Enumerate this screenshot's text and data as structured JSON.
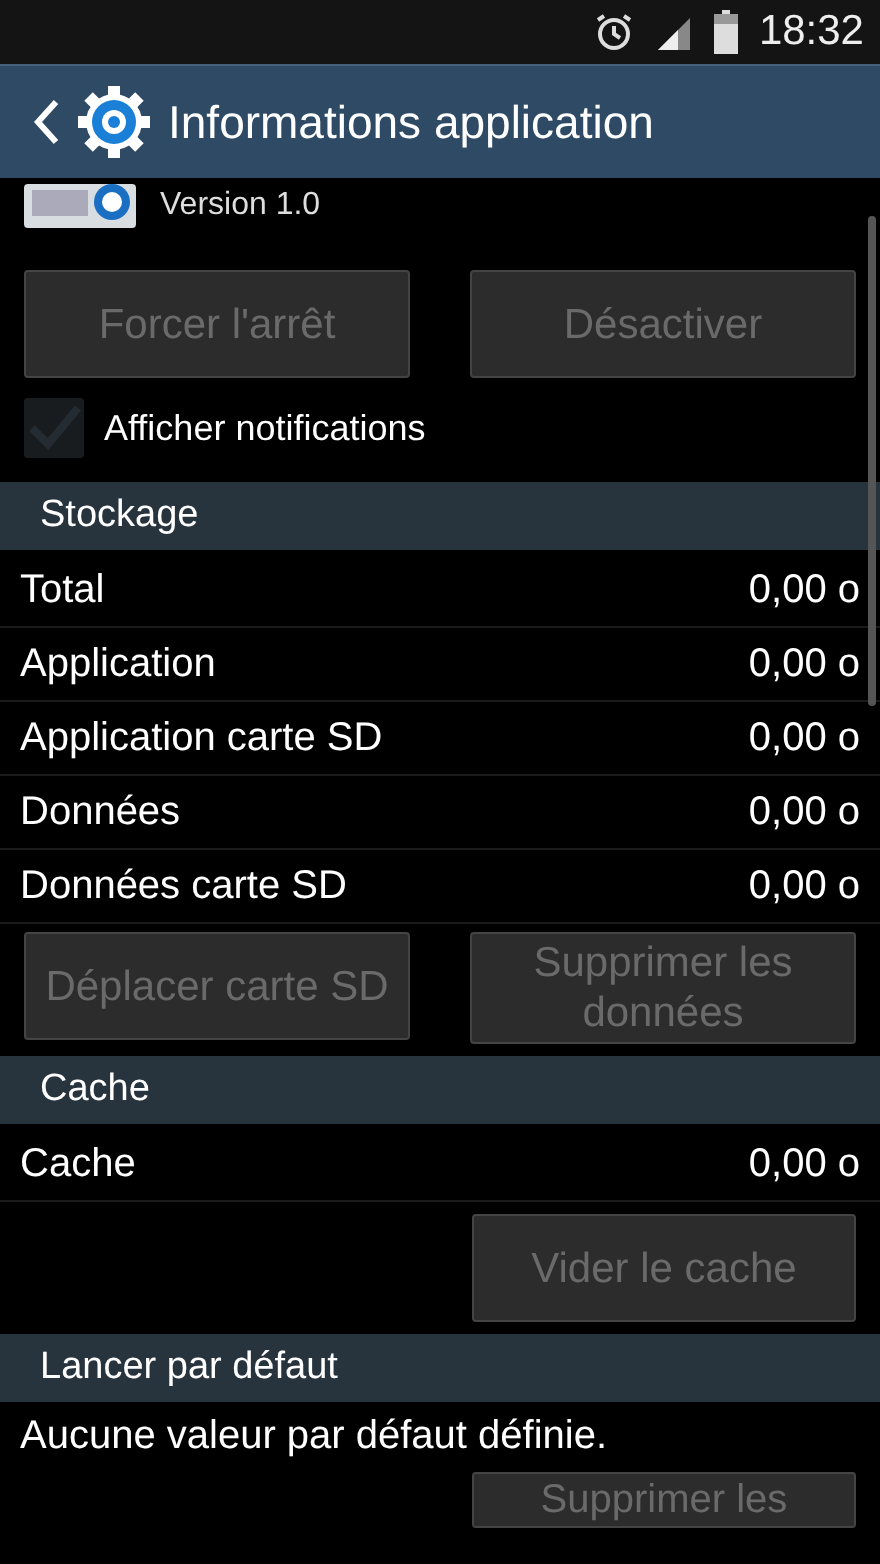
{
  "status_bar": {
    "time": "18:32"
  },
  "title_bar": {
    "title": "Informations application"
  },
  "app": {
    "version": "Version 1.0"
  },
  "app_buttons": [
    {
      "label": "Forcer l'arrêt",
      "disabled": true
    },
    {
      "label": "Désactiver",
      "disabled": true
    }
  ],
  "notifications": {
    "label": "Afficher notifications",
    "checked": true,
    "disabled": true
  },
  "storage": {
    "header": "Stockage",
    "rows": [
      {
        "label": "Total",
        "value": "0,00 o"
      },
      {
        "label": "Application",
        "value": "0,00 o"
      },
      {
        "label": "Application carte SD",
        "value": "0,00 o"
      },
      {
        "label": "Données",
        "value": "0,00 o"
      },
      {
        "label": "Données carte SD",
        "value": "0,00 o"
      }
    ],
    "buttons": [
      {
        "label": "Déplacer carte SD",
        "disabled": true
      },
      {
        "label": "Supprimer les données",
        "disabled": true
      }
    ]
  },
  "cache": {
    "header": "Cache",
    "rows": [
      {
        "label": "Cache",
        "value": "0,00 o"
      }
    ],
    "buttons": [
      {
        "label": "Vider le cache",
        "disabled": true
      }
    ]
  },
  "launch_default": {
    "header": "Lancer par défaut",
    "text": "Aucune valeur par défaut définie.",
    "buttons": [
      {
        "label": "Supprimer les",
        "disabled": true
      }
    ]
  }
}
